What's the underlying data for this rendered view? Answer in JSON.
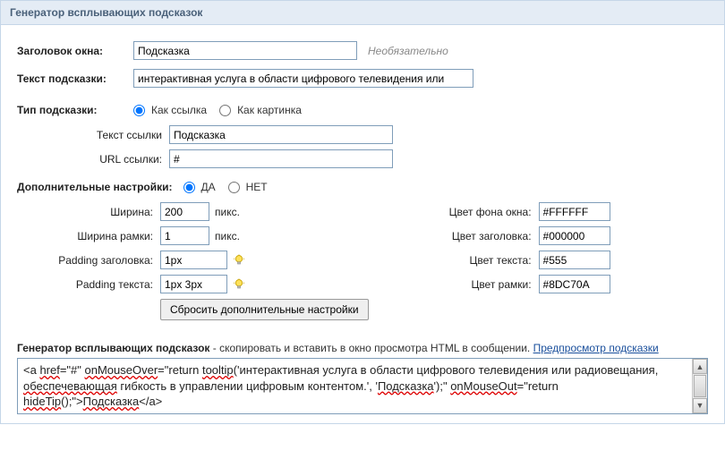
{
  "panel": {
    "title": "Генератор всплывающих подсказок"
  },
  "form": {
    "window_title_label": "Заголовок окна:",
    "window_title_value": "Подсказка",
    "window_title_note": "Необязательно",
    "tip_text_label": "Текст подсказки:",
    "tip_text_value": "интерактивная услуга в области цифрового телевидения или",
    "tip_type_label": "Тип подсказки:",
    "tip_type_opt_link": "Как ссылка",
    "tip_type_opt_image": "Как картинка",
    "link_text_label": "Текст ссылки",
    "link_text_value": "Подсказка",
    "link_url_label": "URL ссылки:",
    "link_url_value": "#",
    "advanced_label": "Дополнительные настройки:",
    "advanced_yes": "ДА",
    "advanced_no": "НЕТ"
  },
  "advanced": {
    "width_label": "Ширина:",
    "width_value": "200",
    "width_unit": "пикс.",
    "border_width_label": "Ширина рамки:",
    "border_width_value": "1",
    "border_width_unit": "пикс.",
    "padding_title_label": "Padding заголовка:",
    "padding_title_value": "1px",
    "padding_text_label": "Padding текста:",
    "padding_text_value": "1px 3px",
    "reset_button": "Сбросить дополнительные настройки",
    "bg_color_label": "Цвет фона окна:",
    "bg_color_value": "#FFFFFF",
    "title_color_label": "Цвет заголовка:",
    "title_color_value": "#000000",
    "text_color_label": "Цвет текста:",
    "text_color_value": "#555",
    "border_color_label": "Цвет рамки:",
    "border_color_value": "#8DC70A"
  },
  "output": {
    "heading_bold": "Генератор всплывающих подсказок",
    "heading_rest": " - скопировать и вставить в окно просмотра HTML в сообщении. ",
    "preview_link": "Предпросмотр подсказки",
    "code_prefix": "<a ",
    "code_href": "href",
    "code_eqhash": "=\"#\" ",
    "code_onmouseover": "onMouseOver",
    "code_eqret": "=\"return ",
    "code_tooltip": "tooltip",
    "code_open": "('интерактивная услуга в области цифрового телевидения или радиовещания, ",
    "code_obespe": "обеспечевающая",
    "code_mid1": " гибкость в управлении цифровым контентом.', '",
    "code_podskazka": "Подсказка",
    "code_closeargs": "');\" ",
    "code_onmouseout": "onMouseOut",
    "code_eqret2": "=\"return ",
    "code_hidetip": "hideTip",
    "code_end1": "();\">",
    "code_podskazka2": "Подсказка",
    "code_end2": "</a>"
  }
}
